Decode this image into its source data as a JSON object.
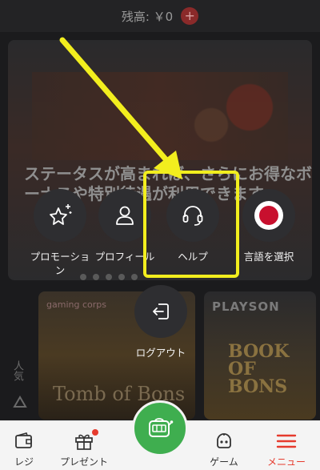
{
  "header": {
    "balance": "残高: ￥0",
    "deposit_icon": "plus-icon",
    "deposit_symbol": "+"
  },
  "banner": {
    "text": "ステータスが高まれば、さらにお得なボーナスや特別待遇が利用できます"
  },
  "games": [
    {
      "provider": "gaming corps",
      "title": "Tomb of Bons"
    },
    {
      "provider": "PLAYSON",
      "title": "BOOK OF BONS"
    }
  ],
  "side_tab": {
    "label": "人気"
  },
  "menu": {
    "items": [
      {
        "label": "プロモーション",
        "icon": "star-sparkle-icon"
      },
      {
        "label": "プロフィール",
        "icon": "user-icon"
      },
      {
        "label": "ヘルプ",
        "icon": "headset-icon"
      },
      {
        "label": "言語を選択",
        "icon": "japan-flag-icon"
      }
    ],
    "logout": {
      "label": "ログアウト",
      "icon": "logout-icon"
    }
  },
  "annotation": {
    "color": "#f2ee1e"
  },
  "bottom_nav": {
    "items": [
      {
        "label": "レジ",
        "icon": "wallet-icon"
      },
      {
        "label": "プレゼント",
        "icon": "gift-icon"
      },
      {
        "label": "",
        "icon": "slot-machine-icon"
      },
      {
        "label": "ゲーム",
        "icon": "gamepad-robot-icon"
      },
      {
        "label": "メニュー",
        "icon": "hamburger-icon"
      }
    ],
    "accent": "#e63b2e",
    "center_color": "#3fae4f"
  }
}
